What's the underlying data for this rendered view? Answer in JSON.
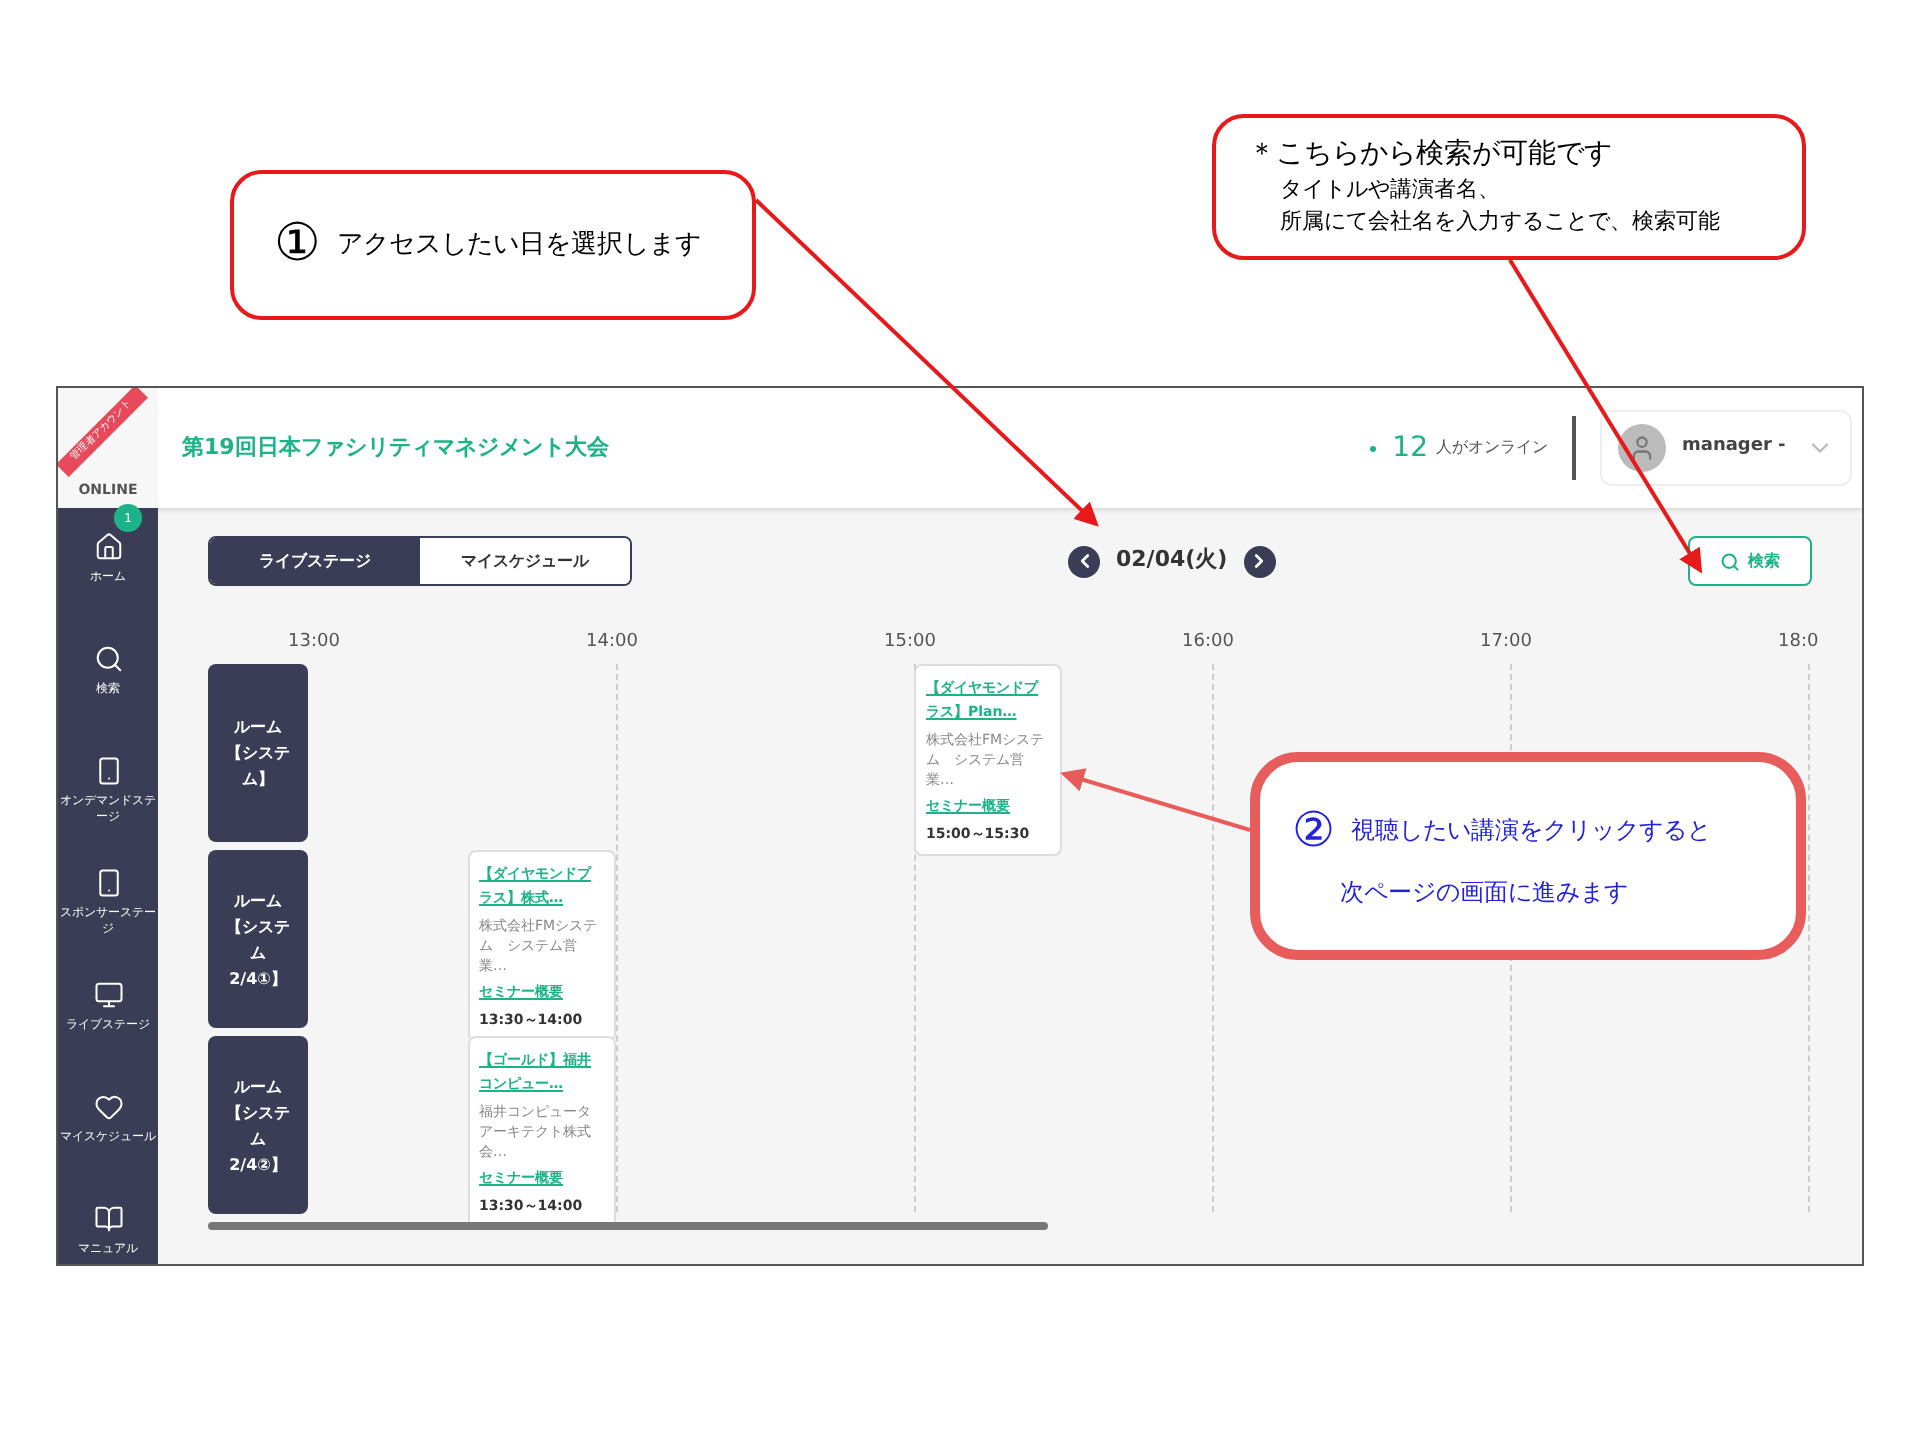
{
  "callouts": [
    {
      "kind": "numbered",
      "number": "①",
      "text": "アクセスしたい日を選択します"
    },
    {
      "kind": "note",
      "text": "＊こちらから検索が可能です",
      "lines": [
        "タイトルや講演者名、",
        "所属にて会社名を入力することで、検索可能"
      ]
    },
    {
      "kind": "numbered-large",
      "number": "②",
      "text": "視聴したい講演をクリックすると",
      "text2": "次ページの画面に進みます"
    }
  ],
  "app": {
    "logo": "ONLINE",
    "ribbon": "管理者アカウント",
    "title": "第19回日本ファシリティマネジメント大会",
    "online_count": "12",
    "online_label": "人がオンライン",
    "user": "manager -",
    "sidebar": [
      {
        "label": "ホーム",
        "badge": "1"
      },
      {
        "label": "検索"
      },
      {
        "label": "オンデマンドステージ"
      },
      {
        "label": "スポンサーステージ"
      },
      {
        "label": "ライブステージ"
      },
      {
        "label": "マイスケジュール"
      },
      {
        "label": "マニュアル"
      }
    ],
    "tabs": [
      {
        "label": "ライブステージ",
        "selected": true
      },
      {
        "label": "マイスケジュール",
        "selected": false
      }
    ],
    "date": "02/04(火)",
    "search_button": "検索",
    "hours": [
      "13:00",
      "14:00",
      "15:00",
      "16:00",
      "17:00",
      "18:0"
    ],
    "rooms": [
      {
        "name": "ルーム【システム】",
        "events": [
          {
            "title": "【ダイヤモンドプラス】Plan…",
            "company": "株式会社FMシステム　システム営業…",
            "link": "セミナー概要",
            "time": "15:00～15:30"
          }
        ]
      },
      {
        "name": "ルーム【システム2/4①】",
        "events": [
          {
            "title": "【ダイヤモンドプラス】株式…",
            "company": "株式会社FMシステム　システム営業…",
            "link": "セミナー概要",
            "time": "13:30～14:00"
          }
        ]
      },
      {
        "name": "ルーム【システム2/4②】",
        "events": [
          {
            "title": "【ゴールド】福井コンピュー…",
            "company": "福井コンピュータアーキテクト株式会…",
            "link": "セミナー概要",
            "time": "13:30～14:00"
          }
        ]
      }
    ]
  }
}
